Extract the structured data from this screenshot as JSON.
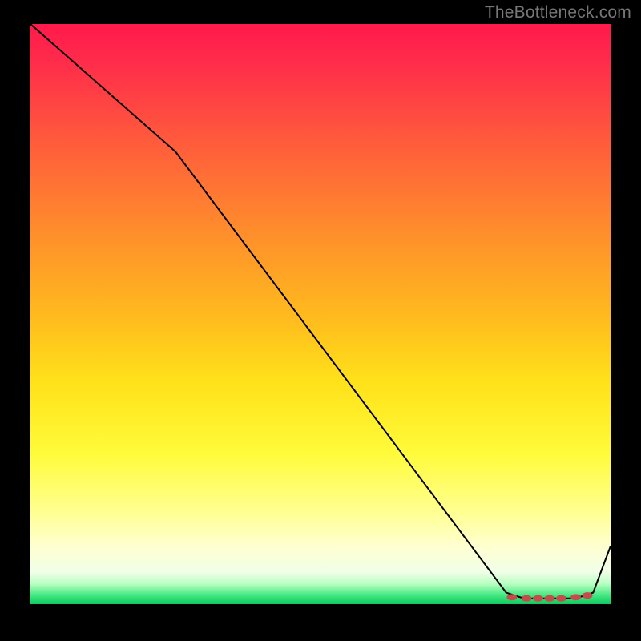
{
  "watermark": "TheBottleneck.com",
  "chart_data": {
    "type": "line",
    "title": "",
    "xlabel": "",
    "ylabel": "",
    "xlim": [
      0,
      100
    ],
    "ylim": [
      0,
      100
    ],
    "grid": false,
    "legend": false,
    "series": [
      {
        "name": "curve",
        "x": [
          0,
          25,
          82,
          85,
          88,
          91,
          94,
          97,
          100
        ],
        "values": [
          100,
          78,
          2,
          1,
          1,
          1,
          1,
          2,
          10
        ]
      }
    ],
    "markers": {
      "name": "points",
      "x": [
        83,
        85.5,
        87.5,
        89.5,
        91.5,
        94,
        96
      ],
      "values": [
        1.2,
        1.0,
        1.0,
        1.0,
        1.0,
        1.2,
        1.5
      ]
    },
    "gradient_stops": [
      {
        "offset": 0.0,
        "color": "#ff1a4b"
      },
      {
        "offset": 0.06,
        "color": "#ff2a4b"
      },
      {
        "offset": 0.2,
        "color": "#ff5a3c"
      },
      {
        "offset": 0.35,
        "color": "#ff8b2d"
      },
      {
        "offset": 0.5,
        "color": "#ffb91e"
      },
      {
        "offset": 0.62,
        "color": "#ffe21a"
      },
      {
        "offset": 0.74,
        "color": "#fffb3a"
      },
      {
        "offset": 0.84,
        "color": "#ffff90"
      },
      {
        "offset": 0.9,
        "color": "#ffffd0"
      },
      {
        "offset": 0.945,
        "color": "#f0ffe8"
      },
      {
        "offset": 0.965,
        "color": "#b8ffc0"
      },
      {
        "offset": 0.985,
        "color": "#40e880"
      },
      {
        "offset": 1.0,
        "color": "#10c860"
      }
    ],
    "line_color": "#000000",
    "marker_color": "#c84b4b"
  }
}
